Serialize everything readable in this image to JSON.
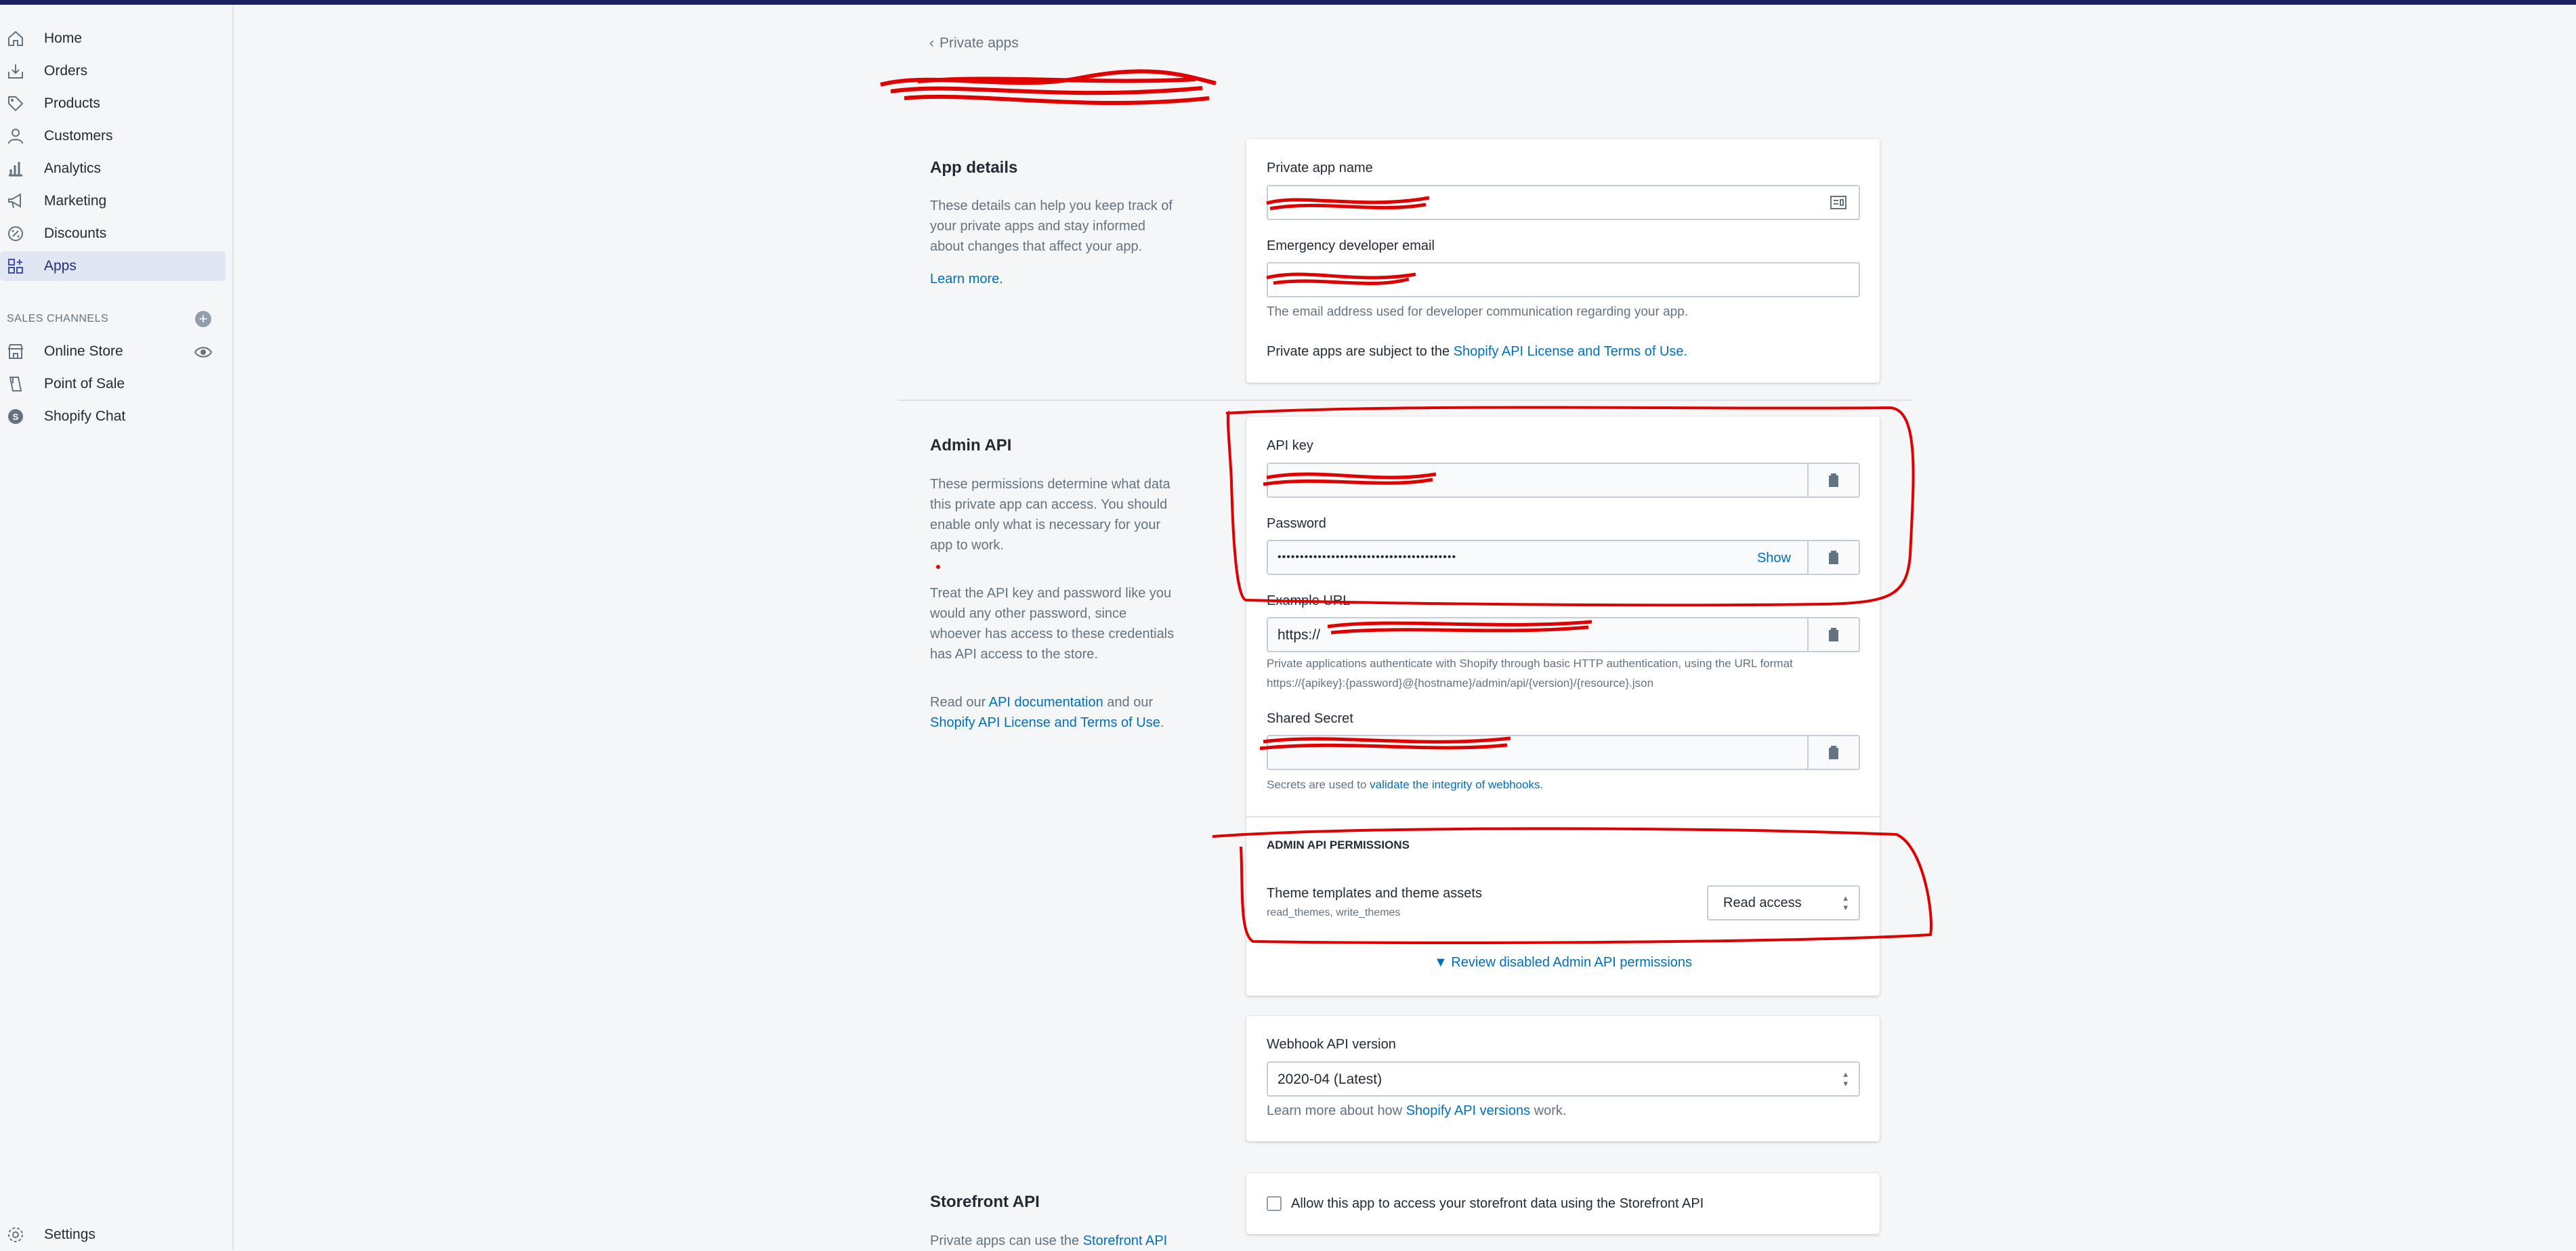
{
  "sidebar": {
    "nav": [
      {
        "label": "Home",
        "icon": "home-icon"
      },
      {
        "label": "Orders",
        "icon": "orders-icon"
      },
      {
        "label": "Products",
        "icon": "tag-icon"
      },
      {
        "label": "Customers",
        "icon": "person-icon"
      },
      {
        "label": "Analytics",
        "icon": "bar-chart-icon"
      },
      {
        "label": "Marketing",
        "icon": "megaphone-icon"
      },
      {
        "label": "Discounts",
        "icon": "discount-icon"
      },
      {
        "label": "Apps",
        "icon": "apps-icon",
        "active": true
      }
    ],
    "sales_channels_label": "SALES CHANNELS",
    "channels": [
      {
        "label": "Online Store",
        "icon": "store-icon"
      },
      {
        "label": "Point of Sale",
        "icon": "pos-icon"
      },
      {
        "label": "Shopify Chat",
        "icon": "chat-icon"
      }
    ],
    "settings_label": "Settings"
  },
  "breadcrumb": {
    "back_label": "Private apps"
  },
  "app_details": {
    "title": "App details",
    "description": "These details can help you keep track of your private apps and stay informed about changes that affect your app.",
    "learn_more": "Learn more.",
    "name_label": "Private app name",
    "email_label": "Emergency developer email",
    "email_help": "The email address used for developer communication regarding your app.",
    "terms_prefix": "Private apps are subject to the ",
    "terms_link": "Shopify API License and Terms of Use."
  },
  "admin_api": {
    "title": "Admin API",
    "description1": "These permissions determine what data this private app can access. You should enable only what is necessary for your app to work.",
    "description2": "Treat the API key and password like you would any other password, since whoever has access to these credentials has API access to the store.",
    "read_prefix": "Read our ",
    "api_doc_link": "API documentation",
    "read_mid": " and our ",
    "license_link": "Shopify API License and Terms of Use",
    "read_suffix": ".",
    "api_key_label": "API key",
    "password_label": "Password",
    "password_value": "••••••••••••••••••••••••••••••••••••••••",
    "show_label": "Show",
    "example_url_label": "Example URL",
    "example_url_value": "https://",
    "auth_help_1": "Private applications authenticate with Shopify through basic HTTP authentication, using the URL format",
    "auth_help_2": "https://{apikey}:{password}@{hostname}/admin/api/{version}/{resource}.json",
    "shared_secret_label": "Shared Secret",
    "secret_help_prefix": "Secrets are used to ",
    "secret_help_link": "validate the integrity of webhooks.",
    "permissions_heading": "ADMIN API PERMISSIONS",
    "permission_name": "Theme templates and theme assets",
    "permission_scopes": "read_themes, write_themes",
    "permission_access": "Read access",
    "review_link": "▼ Review disabled Admin API permissions"
  },
  "webhook": {
    "label": "Webhook API version",
    "value": "2020-04 (Latest)",
    "help_prefix": "Learn more about how ",
    "help_link": "Shopify API versions",
    "help_suffix": " work."
  },
  "storefront": {
    "title": "Storefront API",
    "description_prefix": "Private apps can use the ",
    "description_link": "Storefront API",
    "checkbox_label": "Allow this app to access your storefront data using the Storefront API"
  },
  "colors": {
    "accent": "#006fbb",
    "nav_active": "#e1e6f3",
    "annotation": "#e00000"
  }
}
